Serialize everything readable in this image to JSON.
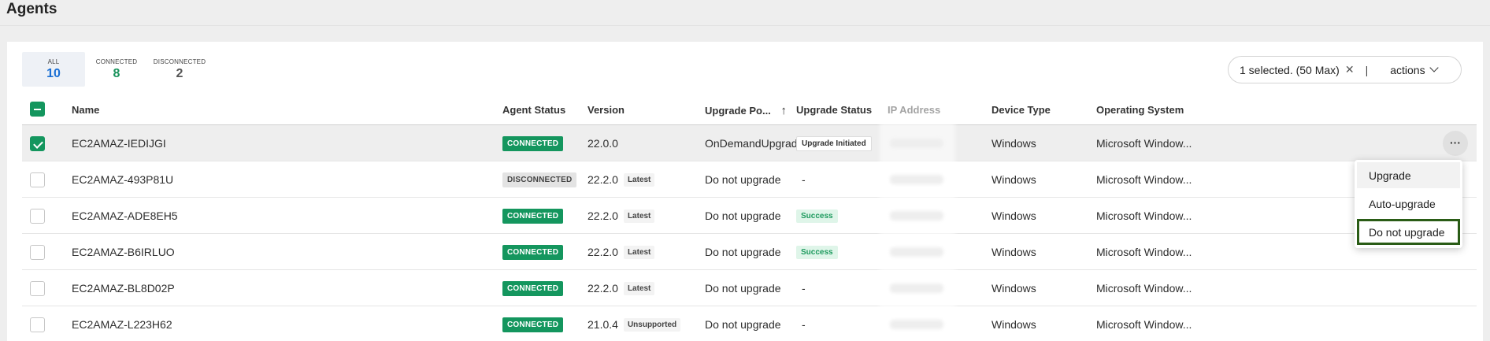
{
  "page": {
    "title": "Agents"
  },
  "filters": [
    {
      "label": "ALL",
      "count": "10"
    },
    {
      "label": "CONNECTED",
      "count": "8"
    },
    {
      "label": "DISCONNECTED",
      "count": "2"
    }
  ],
  "selection": {
    "text": "1 selected. (50 Max)",
    "clear_icon": "✕",
    "divider": "|",
    "actions_label": "actions"
  },
  "columns": {
    "name": "Name",
    "agent_status": "Agent Status",
    "version": "Version",
    "upgrade_policy": "Upgrade Po...",
    "sort_icon": "↑",
    "upgrade_status": "Upgrade Status",
    "ip_address": "IP Address",
    "device_type": "Device Type",
    "os": "Operating System"
  },
  "rows": [
    {
      "name": "EC2AMAZ-IEDIJGI",
      "status": "CONNECTED",
      "version": "22.0.0",
      "version_tag": "",
      "policy": "OnDemandUpgrade",
      "upgrade_status": "Upgrade Initiated",
      "device": "Windows",
      "os": "Microsoft Window..."
    },
    {
      "name": "EC2AMAZ-493P81U",
      "status": "DISCONNECTED",
      "version": "22.2.0",
      "version_tag": "Latest",
      "policy": "Do not upgrade",
      "upgrade_status": "-",
      "device": "Windows",
      "os": "Microsoft Window..."
    },
    {
      "name": "EC2AMAZ-ADE8EH5",
      "status": "CONNECTED",
      "version": "22.2.0",
      "version_tag": "Latest",
      "policy": "Do not upgrade",
      "upgrade_status": "Success",
      "device": "Windows",
      "os": "Microsoft Window..."
    },
    {
      "name": "EC2AMAZ-B6IRLUO",
      "status": "CONNECTED",
      "version": "22.2.0",
      "version_tag": "Latest",
      "policy": "Do not upgrade",
      "upgrade_status": "Success",
      "device": "Windows",
      "os": "Microsoft Window..."
    },
    {
      "name": "EC2AMAZ-BL8D02P",
      "status": "CONNECTED",
      "version": "22.2.0",
      "version_tag": "Latest",
      "policy": "Do not upgrade",
      "upgrade_status": "-",
      "device": "Windows",
      "os": "Microsoft Window..."
    },
    {
      "name": "EC2AMAZ-L223H62",
      "status": "CONNECTED",
      "version": "21.0.4",
      "version_tag": "Unsupported",
      "policy": "Do not upgrade",
      "upgrade_status": "-",
      "device": "Windows",
      "os": "Microsoft Window..."
    }
  ],
  "row_menu": {
    "more_icon": "···",
    "items": [
      "Upgrade",
      "Auto-upgrade",
      "Do not upgrade"
    ]
  },
  "colors": {
    "accent": "#14965e",
    "link": "#1a6fd4",
    "highlight_border": "#2a5c16"
  }
}
